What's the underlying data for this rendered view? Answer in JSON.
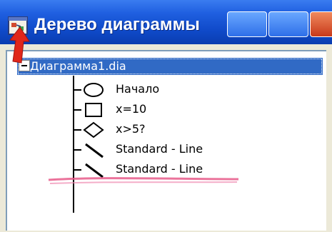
{
  "window": {
    "title": "Дерево диаграммы",
    "title_color": "#ffffff",
    "titlebar_color": "#0f49c8",
    "close_color": "#c8391a"
  },
  "tree": {
    "root_label": "Диаграмма1.dia",
    "root_selected": true,
    "selection_color": "#316ac5",
    "children": [
      {
        "icon": "ellipse-shape-icon",
        "label": "Начало"
      },
      {
        "icon": "rectangle-shape-icon",
        "label": "x=10"
      },
      {
        "icon": "diamond-shape-icon",
        "label": "x>5?"
      },
      {
        "icon": "line-shape-icon",
        "label": "Standard - Line"
      },
      {
        "icon": "line-shape-icon",
        "label": "Standard - Line"
      }
    ]
  },
  "annotations": {
    "arrow_color": "#e0261a",
    "underline_color": "#e85a8a"
  }
}
